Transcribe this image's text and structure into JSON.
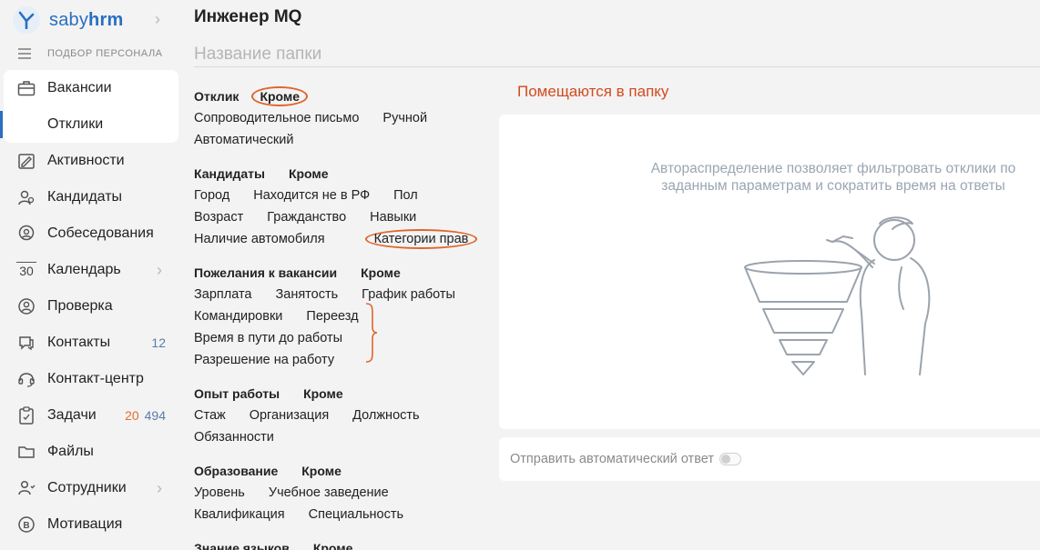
{
  "app": {
    "logo_prefix": "saby",
    "logo_suffix": "hrm",
    "section_label": "ПОДБОР ПЕРСОНАЛА"
  },
  "sidebar": {
    "items": [
      {
        "label": "Вакансии",
        "icon": "briefcase-icon"
      },
      {
        "label": "Отклики",
        "icon": ""
      },
      {
        "label": "Активности",
        "icon": "activity-icon"
      },
      {
        "label": "Кандидаты",
        "icon": "candidates-icon"
      },
      {
        "label": "Собеседования",
        "icon": "interview-icon"
      },
      {
        "label": "Календарь",
        "icon": "calendar-icon",
        "icon_text": "30"
      },
      {
        "label": "Проверка",
        "icon": "check-icon"
      },
      {
        "label": "Контакты",
        "icon": "contacts-icon",
        "count": "12"
      },
      {
        "label": "Контакт-центр",
        "icon": "headset-icon"
      },
      {
        "label": "Задачи",
        "icon": "tasks-icon",
        "count_red": "20",
        "count": "494"
      },
      {
        "label": "Файлы",
        "icon": "files-icon"
      },
      {
        "label": "Сотрудники",
        "icon": "employees-icon"
      },
      {
        "label": "Мотивация",
        "icon": "motivation-icon"
      }
    ]
  },
  "main": {
    "title": "Инженер MQ",
    "folder_placeholder": "Название папки",
    "except_label": "Кроме",
    "groups": [
      {
        "title": "Отклик",
        "rows": [
          [
            "Сопроводительное письмо",
            "Ручной"
          ],
          [
            "Автоматический"
          ]
        ]
      },
      {
        "title": "Кандидаты",
        "rows": [
          [
            "Город",
            "Находится не в РФ",
            "Пол"
          ],
          [
            "Возраст",
            "Гражданство",
            "Навыки"
          ],
          [
            "Наличие автомобиля",
            "Категории прав"
          ]
        ]
      },
      {
        "title": "Пожелания к вакансии",
        "rows": [
          [
            "Зарплата",
            "Занятость",
            "График работы"
          ],
          [
            "Командировки",
            "Переезд"
          ],
          [
            "Время в пути до работы"
          ],
          [
            "Разрешение на работу"
          ]
        ]
      },
      {
        "title": "Опыт работы",
        "rows": [
          [
            "Стаж",
            "Организация",
            "Должность"
          ],
          [
            "Обязанности"
          ]
        ]
      },
      {
        "title": "Образование",
        "rows": [
          [
            "Уровень",
            "Учебное заведение"
          ],
          [
            "Квалификация",
            "Специальность"
          ]
        ]
      },
      {
        "title": "Знание языков",
        "rows": []
      }
    ],
    "right_title": "Помещаются в папку",
    "card_text": "Автораспределение позволяет фильтровать отклики по заданным параметрам и сократить время на ответы",
    "auto_reply_label": "Отправить автоматический ответ"
  },
  "colors": {
    "accent": "#2a6fc0",
    "highlight": "#e0642b",
    "right_title": "#d24b1e"
  }
}
